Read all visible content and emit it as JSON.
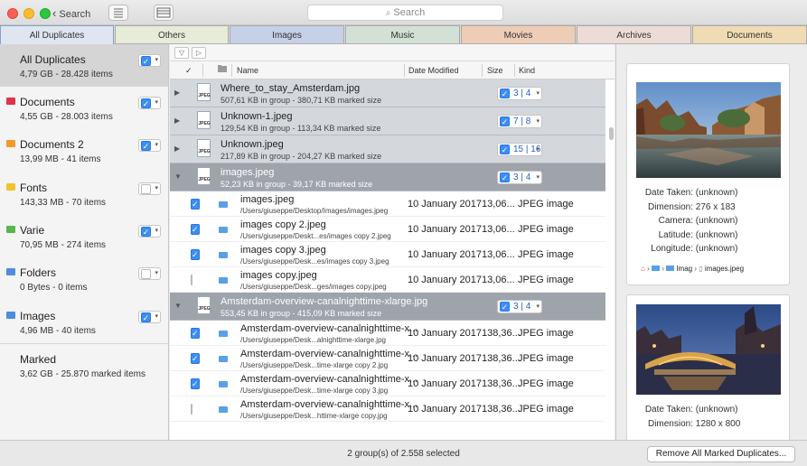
{
  "toolbar": {
    "back_label": "Search",
    "search_placeholder": "Search"
  },
  "colors": {
    "accent": "#3b8ef5",
    "selected_group": "#9fa4ab",
    "group_bg": "#d4d7dc"
  },
  "tabs": [
    {
      "label": "All Duplicates",
      "color": "#dfe6f1"
    },
    {
      "label": "Others",
      "color": "#e7ecd8"
    },
    {
      "label": "Images",
      "color": "#c6d0e6"
    },
    {
      "label": "Music",
      "color": "#d3e0d6"
    },
    {
      "label": "Movies",
      "color": "#edcdb6"
    },
    {
      "label": "Archives",
      "color": "#eddcd5"
    },
    {
      "label": "Documents",
      "color": "#efdcb4"
    }
  ],
  "sidebar": {
    "items": [
      {
        "title": "All Duplicates",
        "sub": "4,79 GB - 28.428 items",
        "checked": true,
        "folder_color": ""
      },
      {
        "title": "Documents",
        "sub": "4,55 GB - 28.003 items",
        "checked": true,
        "folder_color": "#e0334a"
      },
      {
        "title": "Documents 2",
        "sub": "13,99 MB - 41 items",
        "checked": true,
        "folder_color": "#f29a2e"
      },
      {
        "title": "Fonts",
        "sub": "143,33 MB - 70 items",
        "checked": false,
        "folder_color": "#f2c12e"
      },
      {
        "title": "Varie",
        "sub": "70,95 MB - 274 items",
        "checked": true,
        "folder_color": "#56b84a"
      },
      {
        "title": "Folders",
        "sub": "0 Bytes - 0 items",
        "checked": false,
        "folder_color": "#4f8de0"
      },
      {
        "title": "Images",
        "sub": "4,96 MB - 40 items",
        "checked": true,
        "folder_color": "#4f8de0"
      },
      {
        "title": "Marked",
        "sub": "3,62 GB - 25.870 marked items",
        "checked": false,
        "folder_color": ""
      }
    ]
  },
  "columns": {
    "check": "✓",
    "name": "Name",
    "date": "Date Modified",
    "size": "Size",
    "kind": "Kind"
  },
  "groups": [
    {
      "name": "Where_to_stay_Amsterdam.jpg",
      "info": "507,61 KB in group - 380,71 KB marked size",
      "count": "3 | 4",
      "selected": false
    },
    {
      "name": "Unknown-1.jpeg",
      "info": "129,54 KB in group - 113,34 KB marked size",
      "count": "7 | 8",
      "selected": false
    },
    {
      "name": "Unknown.jpeg",
      "info": "217,89 KB in group - 204,27 KB marked size",
      "count": "15 | 16",
      "selected": false
    },
    {
      "name": "images.jpeg",
      "info": "52,23 KB in group - 39,17 KB marked size",
      "count": "3 | 4",
      "selected": true,
      "rows": [
        {
          "name": "images.jpeg",
          "path": "/Users/giuseppe/Desktop/Images/images.jpeg",
          "date": "10 January 2017",
          "size": "13,06...",
          "kind": "JPEG image",
          "checked": true
        },
        {
          "name": "images copy 2.jpeg",
          "path": "/Users/giuseppe/Deskt...es/images copy 2.jpeg",
          "date": "10 January 2017",
          "size": "13,06...",
          "kind": "JPEG image",
          "checked": true
        },
        {
          "name": "images copy 3.jpeg",
          "path": "/Users/giuseppe/Desk...es/images copy 3.jpeg",
          "date": "10 January 2017",
          "size": "13,06...",
          "kind": "JPEG image",
          "checked": true
        },
        {
          "name": "images copy.jpeg",
          "path": "/Users/giuseppe/Desk...ges/images copy.jpeg",
          "date": "10 January 2017",
          "size": "13,06...",
          "kind": "JPEG image",
          "checked": false
        }
      ]
    },
    {
      "name": "Amsterdam-overview-canalnighttime-xlarge.jpg",
      "info": "553,45 KB in group - 415,09 KB marked size",
      "count": "3 | 4",
      "selected": true,
      "rows": [
        {
          "name": "Amsterdam-overview-canalnighttime-x...",
          "path": "/Users/giuseppe/Desk...alnighttime-xlarge.jpg",
          "date": "10 January 2017",
          "size": "138,36...",
          "kind": "JPEG image",
          "checked": true
        },
        {
          "name": "Amsterdam-overview-canalnighttime-x...",
          "path": "/Users/giuseppe/Desk...time-xlarge copy 2.jpg",
          "date": "10 January 2017",
          "size": "138,36...",
          "kind": "JPEG image",
          "checked": true
        },
        {
          "name": "Amsterdam-overview-canalnighttime-x...",
          "path": "/Users/giuseppe/Desk...time-xlarge copy 3.jpg",
          "date": "10 January 2017",
          "size": "138,36...",
          "kind": "JPEG image",
          "checked": true
        },
        {
          "name": "Amsterdam-overview-canalnighttime-x...",
          "path": "/Users/giuseppe/Desk...httime-xlarge copy.jpg",
          "date": "10 January 2017",
          "size": "138,36...",
          "kind": "JPEG image",
          "checked": false
        }
      ]
    }
  ],
  "preview1": {
    "meta": [
      {
        "k": "Date Taken:",
        "v": "(unknown)"
      },
      {
        "k": "Dimension:",
        "v": "276 x 183"
      },
      {
        "k": "Camera:",
        "v": "(unknown)"
      },
      {
        "k": "Latitude:",
        "v": "(unknown)"
      },
      {
        "k": "Longitude:",
        "v": "(unknown)"
      }
    ],
    "path_folder": "Imag",
    "path_file": "images.jpeg"
  },
  "preview2": {
    "meta": [
      {
        "k": "Date Taken:",
        "v": "(unknown)"
      },
      {
        "k": "Dimension:",
        "v": "1280 x 800"
      }
    ]
  },
  "status": "2 group(s) of 2.558 selected",
  "remove_button": "Remove All Marked Duplicates..."
}
